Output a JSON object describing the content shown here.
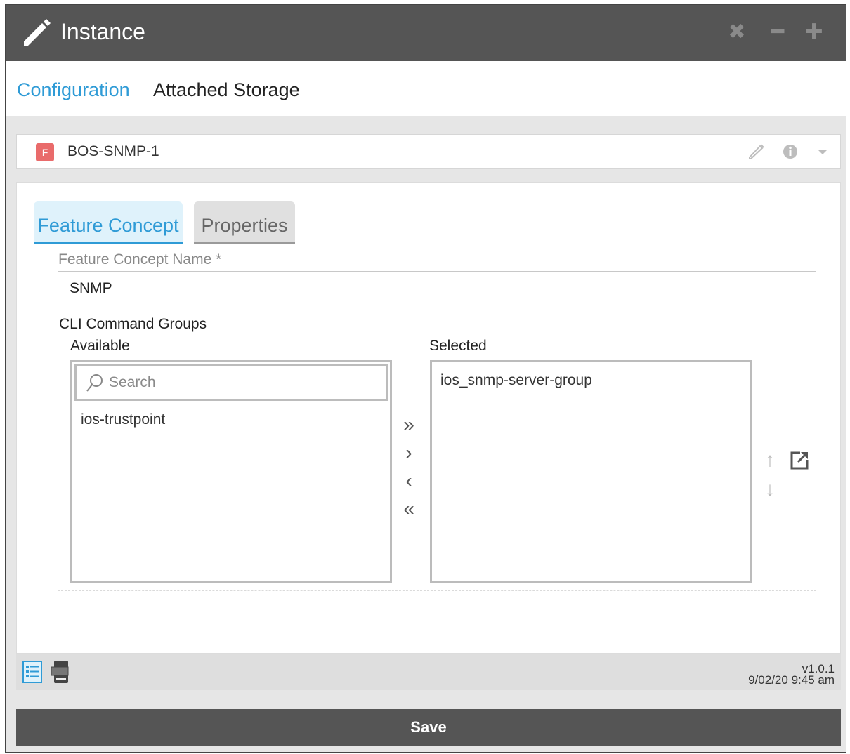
{
  "window": {
    "title": "Instance",
    "controls": {
      "close": "✖",
      "minimize": "━",
      "maximize": "✚"
    }
  },
  "nav": {
    "tabs": [
      {
        "label": "Configuration",
        "active": true
      },
      {
        "label": "Attached Storage",
        "active": false
      }
    ]
  },
  "instance": {
    "badge": "F",
    "name": "BOS-SNMP-1",
    "icons": [
      "pencil-icon",
      "info-icon",
      "chevron-down-icon"
    ]
  },
  "tabs": [
    {
      "label": "Feature Concept",
      "active": true
    },
    {
      "label": "Properties",
      "active": false
    }
  ],
  "form": {
    "name_label": "Feature Concept Name *",
    "name_value": "SNMP",
    "cli_label": "CLI Command Groups",
    "available_label": "Available",
    "selected_label": "Selected",
    "search_placeholder": "Search",
    "available_items": [
      "ios-trustpoint"
    ],
    "selected_items": [
      "ios_snmp-server-group"
    ],
    "move_buttons": {
      "all_right": "»",
      "right": "›",
      "left": "‹",
      "all_left": "«"
    },
    "order_buttons": {
      "up": "↑",
      "down": "↓"
    }
  },
  "footer": {
    "version": "v1.0.1",
    "timestamp": "9/02/20 9:45 am",
    "icons": [
      "list-view-icon",
      "json-view-icon"
    ]
  },
  "actions": {
    "save_label": "Save"
  },
  "colors": {
    "accent": "#2f9bd6",
    "titlebar": "#555555",
    "badge": "#e96b6b"
  }
}
